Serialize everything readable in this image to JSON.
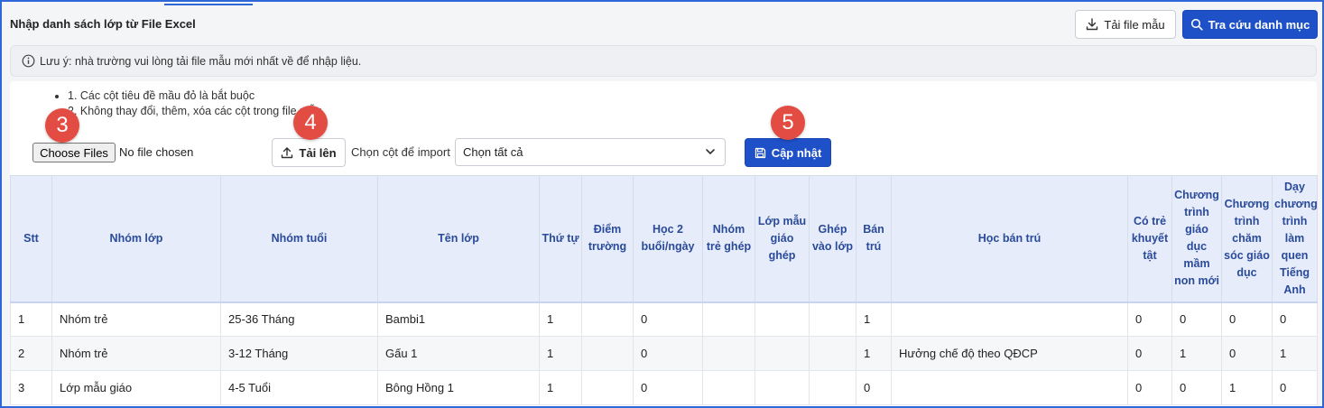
{
  "header": {
    "title": "Nhập danh sách lớp từ File Excel",
    "download_template_label": "Tải file mẫu",
    "lookup_catalog_label": "Tra cứu danh mục"
  },
  "note": {
    "text": "Lưu ý: nhà trường vui lòng tải file mẫu mới nhất về để nhập liệu."
  },
  "rules": [
    "1. Các cột tiêu đề mầu đỏ là bắt buộc",
    "2. Không thay đổi, thêm, xóa các cột trong file mẫu"
  ],
  "upload": {
    "choose_files_label": "Choose Files",
    "file_status": "No file chosen",
    "upload_label": "Tải lên",
    "import_columns_label": "Chọn cột để import",
    "import_columns_value": "Chọn tất cả",
    "update_label": "Cập nhật"
  },
  "badges": [
    "3",
    "4",
    "5"
  ],
  "table": {
    "columns": [
      "Stt",
      "Nhóm lớp",
      "Nhóm tuổi",
      "Tên lớp",
      "Thứ tự",
      "Điểm trường",
      "Học 2 buổi/ngày",
      "Nhóm trẻ ghép",
      "Lớp mẫu giáo ghép",
      "Ghép vào lớp",
      "Bán trú",
      "Học bán trú",
      "Có trẻ khuyết tật",
      "Chương trình giáo dục mầm non mới",
      "Chương trình chăm sóc giáo dục",
      "Dạy chương trình làm quen Tiếng Anh"
    ],
    "rows": [
      [
        "1",
        "Nhóm trẻ",
        "25-36 Tháng",
        "Bambi1",
        "1",
        "",
        "0",
        "",
        "",
        "",
        "1",
        "",
        "0",
        "0",
        "0",
        "0"
      ],
      [
        "2",
        "Nhóm trẻ",
        "3-12 Tháng",
        "Gấu 1",
        "1",
        "",
        "0",
        "",
        "",
        "",
        "1",
        "Hưởng chế độ theo QĐCP",
        "0",
        "1",
        "0",
        "1"
      ],
      [
        "3",
        "Lớp mẫu giáo",
        "4-5 Tuổi",
        "Bông Hồng 1",
        "1",
        "",
        "0",
        "",
        "",
        "",
        "0",
        "",
        "0",
        "0",
        "1",
        "0"
      ]
    ]
  },
  "colors": {
    "primary": "#1e50c8",
    "badge": "#e24c43",
    "header_bg": "#e6ecfa",
    "header_text": "#2a4a9a"
  }
}
